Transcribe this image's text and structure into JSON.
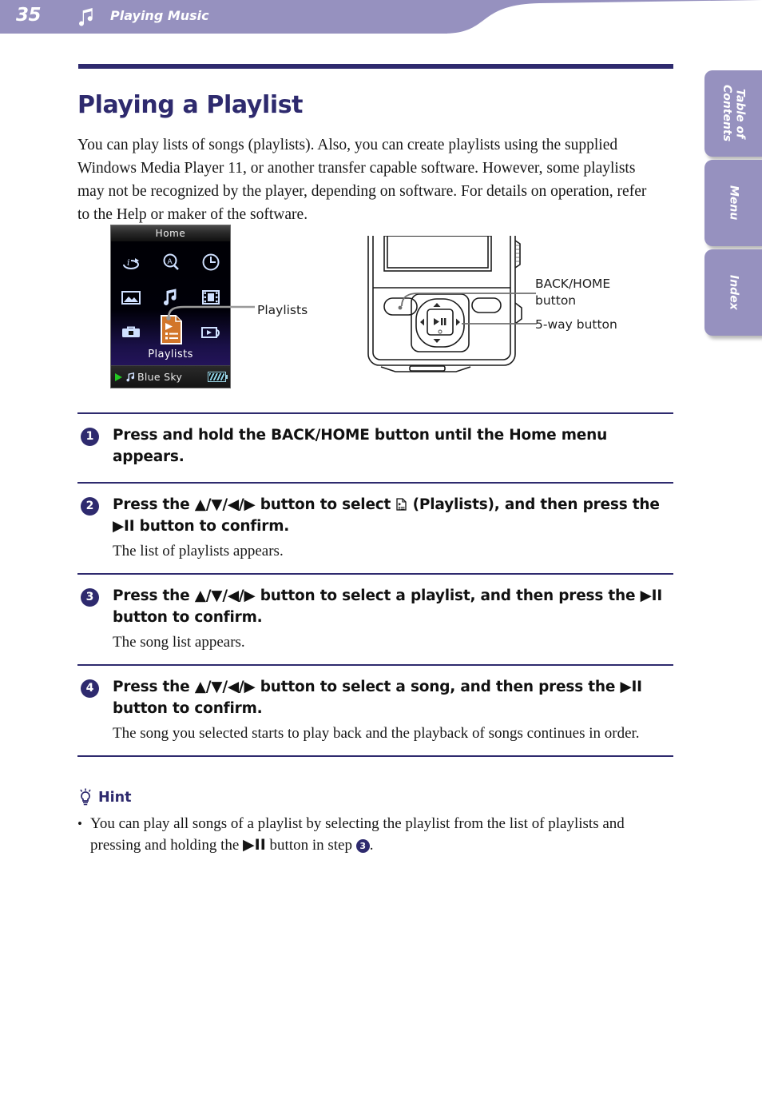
{
  "header": {
    "page_number": "35",
    "section_title": "Playing Music",
    "note_icon": "music-note-icon",
    "band_color": "#9691bf"
  },
  "side_tabs": [
    {
      "label": "Table of\nContents",
      "name": "table-of-contents"
    },
    {
      "label": "Menu",
      "name": "menu"
    },
    {
      "label": "Index",
      "name": "index"
    }
  ],
  "page": {
    "title": "Playing a Playlist",
    "title_color": "#2e2a6e",
    "intro": "You can play lists of songs (playlists). Also, you can create playlists using the supplied Windows Media Player 11, or another transfer capable software. However, some playlists may not be recognized by the player, depending on software. For details on operation, refer to the Help or maker of the software."
  },
  "device_screen": {
    "titlebar": "Home",
    "selected_label": "Playlists",
    "status_song": "Blue Sky",
    "play_indicator_color": "#23c723",
    "highlight_color": "#d2762a",
    "icons": [
      {
        "name": "intelligent-shuffle-icon",
        "row": 0,
        "col": 0
      },
      {
        "name": "search-icon",
        "row": 0,
        "col": 1
      },
      {
        "name": "clock-icon",
        "row": 0,
        "col": 2
      },
      {
        "name": "photo-icon",
        "row": 1,
        "col": 0
      },
      {
        "name": "music-icon",
        "row": 1,
        "col": 1
      },
      {
        "name": "video-icon",
        "row": 1,
        "col": 2
      },
      {
        "name": "settings-icon",
        "row": 2,
        "col": 0
      },
      {
        "name": "playlists-icon",
        "row": 2,
        "col": 1
      },
      {
        "name": "now-playing-icon",
        "row": 2,
        "col": 2
      }
    ]
  },
  "callouts": {
    "playlists": "Playlists",
    "back_home": "BACK/HOME\nbutton",
    "five_way": "5-way button"
  },
  "steps": [
    {
      "number": "1",
      "head_parts": [
        {
          "t": "Press and hold the BACK/HOME button until the Home menu appears."
        }
      ],
      "body": ""
    },
    {
      "number": "2",
      "head_parts": [
        {
          "t": "Press the "
        },
        {
          "g": "▲/▼/◀/▶"
        },
        {
          "t": " button to select "
        },
        {
          "icon": "playlists-doc-icon"
        },
        {
          "t": " (Playlists), and then press the "
        },
        {
          "g": "▶II"
        },
        {
          "t": " button to confirm."
        }
      ],
      "body": "The list of playlists appears."
    },
    {
      "number": "3",
      "head_parts": [
        {
          "t": "Press the "
        },
        {
          "g": "▲/▼/◀/▶"
        },
        {
          "t": " button to select a playlist, and then press the "
        },
        {
          "g": "▶II"
        },
        {
          "t": " button to confirm."
        }
      ],
      "body": "The song list appears."
    },
    {
      "number": "4",
      "head_parts": [
        {
          "t": "Press the "
        },
        {
          "g": "▲/▼/◀/▶"
        },
        {
          "t": " button to select a song, and then press the "
        },
        {
          "g": "▶II"
        },
        {
          "t": " button to confirm."
        }
      ],
      "body": "The song you selected starts to play back and the playback of songs continues in order."
    }
  ],
  "hint": {
    "title": "Hint",
    "icon": "lightbulb-icon",
    "bullet": "•",
    "item_parts": [
      {
        "t": "You can play all songs of a playlist by selecting the playlist from the list of playlists and pressing and holding the "
      },
      {
        "g": "▶II"
      },
      {
        "t": " button in step "
      },
      {
        "num": "3"
      },
      {
        "t": "."
      }
    ]
  }
}
